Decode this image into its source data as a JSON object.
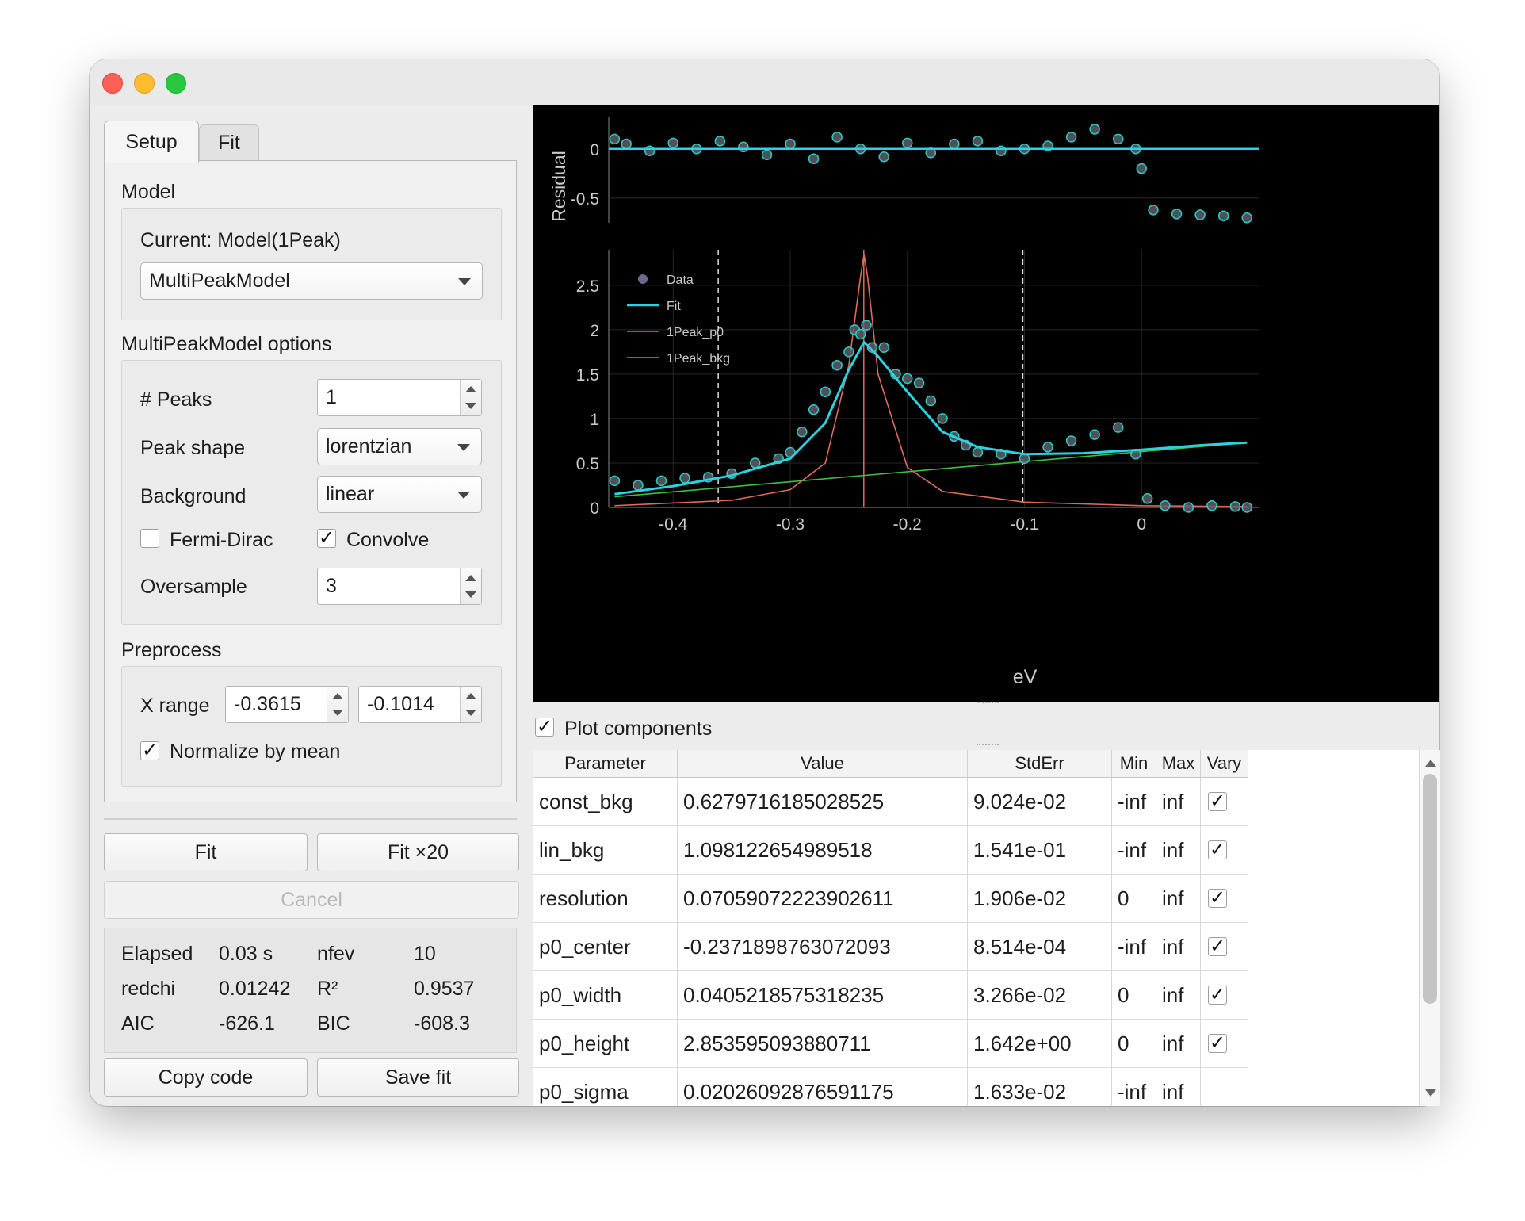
{
  "tabs": [
    {
      "label": "Setup"
    },
    {
      "label": "Fit"
    }
  ],
  "model": {
    "section_title": "Model",
    "current_label": "Current: Model(1Peak)",
    "model_select": "MultiPeakModel"
  },
  "options": {
    "section_title": "MultiPeakModel options",
    "peaks_label": "# Peaks",
    "peaks_value": "1",
    "shape_label": "Peak shape",
    "shape_value": "lorentzian",
    "background_label": "Background",
    "background_value": "linear",
    "fermi_dirac_label": "Fermi-Dirac",
    "fermi_dirac_checked": false,
    "convolve_label": "Convolve",
    "convolve_checked": true,
    "oversample_label": "Oversample",
    "oversample_value": "3"
  },
  "preprocess": {
    "section_title": "Preprocess",
    "xrange_label": "X range",
    "xmin": "-0.3615",
    "xmax": "-0.1014",
    "normalize_label": "Normalize by mean",
    "normalize_checked": true
  },
  "actions": {
    "fit": "Fit",
    "fit20": "Fit ×20",
    "cancel": "Cancel",
    "copy_code": "Copy code",
    "save_fit": "Save fit"
  },
  "stats": {
    "elapsed_label": "Elapsed",
    "elapsed_value": "0.03 s",
    "nfev_label": "nfev",
    "nfev_value": "10",
    "redchi_label": "redchi",
    "redchi_value": "0.01242",
    "r2_label": "R²",
    "r2_value": "0.9537",
    "aic_label": "AIC",
    "aic_value": "-626.1",
    "bic_label": "BIC",
    "bic_value": "-608.3"
  },
  "plot": {
    "residual_ylabel": "Residual",
    "xlabel": "eV",
    "plot_components_label": "Plot components",
    "plot_components_checked": true,
    "colors": {
      "data": "#5e5e66",
      "data_edge": "#2fc9c9",
      "fit": "#29d4e0",
      "peak": "#e06a5a",
      "bkg": "#3fbf3f",
      "bounds": "#dddddd"
    }
  },
  "chart_data": [
    {
      "type": "scatter",
      "panel": "residual",
      "ylabel": "Residual",
      "ylim": [
        -0.75,
        0.32
      ],
      "xlim": [
        -0.455,
        0.1
      ],
      "yticks": [
        "0",
        "-0.5"
      ],
      "series": [
        {
          "name": "",
          "kind": "residual_points",
          "x": [
            -0.45,
            -0.44,
            -0.42,
            -0.4,
            -0.38,
            -0.36,
            -0.34,
            -0.32,
            -0.3,
            -0.28,
            -0.26,
            -0.24,
            -0.22,
            -0.2,
            -0.18,
            -0.16,
            -0.14,
            -0.12,
            -0.1,
            -0.08,
            -0.06,
            -0.04,
            -0.02,
            -0.005,
            0.0,
            0.01,
            0.03,
            0.05,
            0.07,
            0.09
          ],
          "y": [
            0.1,
            0.05,
            -0.02,
            0.06,
            0.0,
            0.08,
            0.02,
            -0.06,
            0.05,
            -0.1,
            0.12,
            0.0,
            -0.08,
            0.06,
            -0.04,
            0.05,
            0.08,
            -0.02,
            0.0,
            0.03,
            0.12,
            0.2,
            0.1,
            0.0,
            -0.2,
            -0.62,
            -0.66,
            -0.67,
            -0.68,
            -0.7
          ]
        },
        {
          "name": "",
          "kind": "zero_line",
          "x": [
            -0.455,
            0.1
          ],
          "y": [
            0,
            0
          ]
        }
      ]
    },
    {
      "type": "scatter",
      "panel": "main",
      "xlabel": "eV",
      "xlim": [
        -0.455,
        0.1
      ],
      "ylim": [
        0,
        2.9
      ],
      "xticks": [
        "-0.4",
        "-0.3",
        "-0.2",
        "-0.1",
        "0"
      ],
      "yticks": [
        "0",
        "0.5",
        "1",
        "1.5",
        "2",
        "2.5"
      ],
      "legend": "top-left",
      "grid": true,
      "vlines": [
        -0.3615,
        -0.1014,
        -0.2372
      ],
      "series": [
        {
          "name": "Data",
          "x": [
            -0.45,
            -0.43,
            -0.41,
            -0.39,
            -0.37,
            -0.35,
            -0.33,
            -0.31,
            -0.3,
            -0.29,
            -0.28,
            -0.27,
            -0.26,
            -0.25,
            -0.245,
            -0.24,
            -0.235,
            -0.23,
            -0.22,
            -0.21,
            -0.2,
            -0.19,
            -0.18,
            -0.17,
            -0.16,
            -0.15,
            -0.14,
            -0.12,
            -0.1,
            -0.08,
            -0.06,
            -0.04,
            -0.02,
            -0.005,
            0.005,
            0.02,
            0.04,
            0.06,
            0.08,
            0.09
          ],
          "y": [
            0.3,
            0.25,
            0.3,
            0.33,
            0.34,
            0.38,
            0.5,
            0.55,
            0.62,
            0.85,
            1.1,
            1.3,
            1.6,
            1.75,
            2.0,
            1.95,
            2.05,
            1.8,
            1.8,
            1.5,
            1.45,
            1.4,
            1.2,
            1.0,
            0.8,
            0.7,
            0.62,
            0.6,
            0.55,
            0.68,
            0.75,
            0.82,
            0.9,
            0.6,
            0.1,
            0.02,
            0.0,
            0.02,
            0.01,
            0.0
          ]
        },
        {
          "name": "Fit",
          "x": [
            -0.45,
            -0.4,
            -0.35,
            -0.3,
            -0.27,
            -0.25,
            -0.237,
            -0.225,
            -0.2,
            -0.17,
            -0.14,
            -0.1,
            -0.05,
            0.0,
            0.05,
            0.09
          ],
          "y": [
            0.15,
            0.24,
            0.36,
            0.55,
            0.95,
            1.55,
            1.86,
            1.7,
            1.3,
            0.85,
            0.68,
            0.6,
            0.61,
            0.65,
            0.7,
            0.73
          ]
        },
        {
          "name": "1Peak_p0",
          "x": [
            -0.45,
            -0.35,
            -0.3,
            -0.27,
            -0.25,
            -0.24,
            -0.237,
            -0.234,
            -0.225,
            -0.2,
            -0.17,
            -0.1,
            0.0,
            0.09
          ],
          "y": [
            0.02,
            0.08,
            0.2,
            0.5,
            1.6,
            2.6,
            2.85,
            2.6,
            1.5,
            0.45,
            0.18,
            0.06,
            0.02,
            0.01
          ]
        },
        {
          "name": "1Peak_bkg",
          "x": [
            -0.45,
            0.09
          ],
          "y": [
            0.12,
            0.73
          ]
        }
      ]
    },
    {
      "type": "table",
      "columns": [
        "Parameter",
        "Value",
        "StdErr",
        "Min",
        "Max",
        "Vary"
      ],
      "rows": [
        {
          "param": "const_bkg",
          "value": "0.6279716185028525",
          "stderr": "9.024e-02",
          "min": "-inf",
          "max": "inf",
          "vary": true
        },
        {
          "param": "lin_bkg",
          "value": "1.098122654989518",
          "stderr": "1.541e-01",
          "min": "-inf",
          "max": "inf",
          "vary": true
        },
        {
          "param": "resolution",
          "value": "0.07059072223902611",
          "stderr": "1.906e-02",
          "min": "0",
          "max": "inf",
          "vary": true
        },
        {
          "param": "p0_center",
          "value": "-0.2371898763072093",
          "stderr": "8.514e-04",
          "min": "-inf",
          "max": "inf",
          "vary": true
        },
        {
          "param": "p0_width",
          "value": "0.0405218575318235",
          "stderr": "3.266e-02",
          "min": "0",
          "max": "inf",
          "vary": true
        },
        {
          "param": "p0_height",
          "value": "2.853595093880711",
          "stderr": "1.642e+00",
          "min": "0",
          "max": "inf",
          "vary": true
        },
        {
          "param": "p0_sigma",
          "value": "0.02026092876591175",
          "stderr": "1.633e-02",
          "min": "-inf",
          "max": "inf",
          "vary": false
        }
      ]
    }
  ]
}
